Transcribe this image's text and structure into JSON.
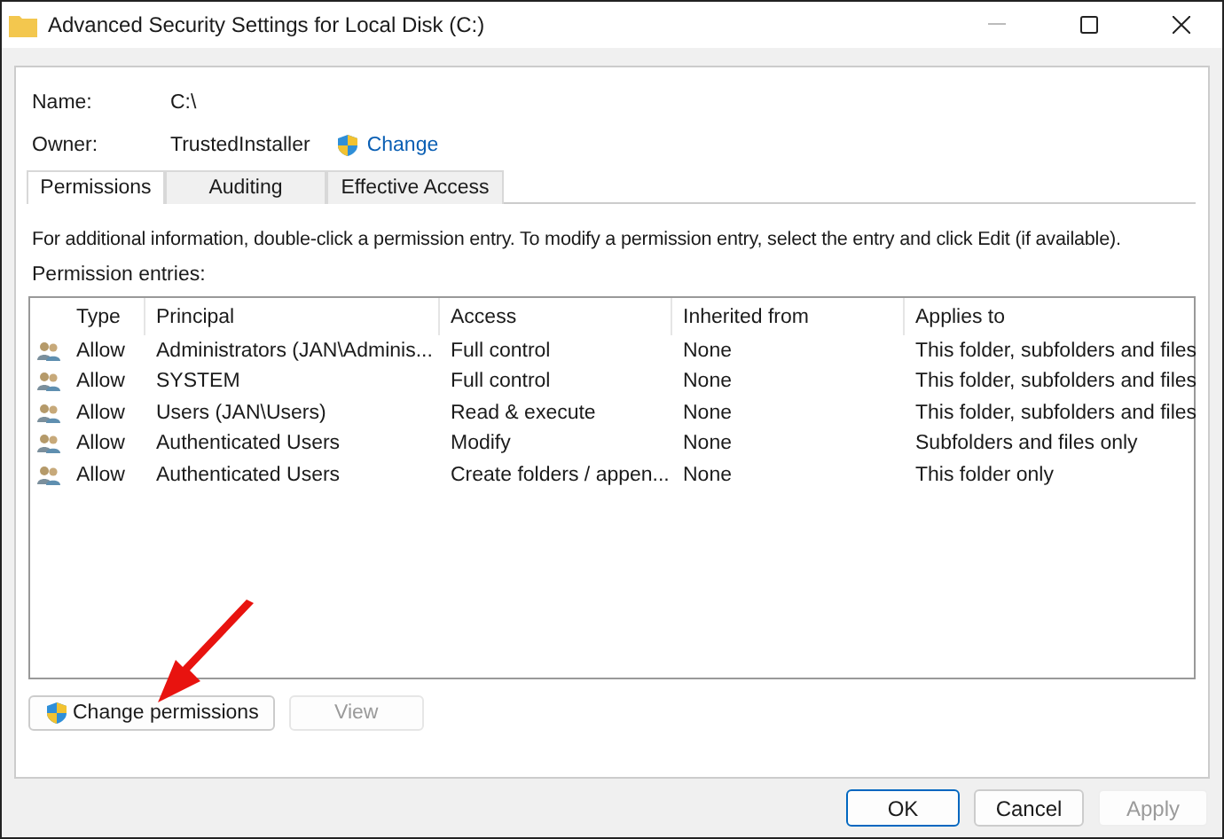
{
  "window": {
    "title": "Advanced Security Settings for Local Disk (C:)"
  },
  "name_field": {
    "label": "Name:",
    "value": "C:\\"
  },
  "owner": {
    "label": "Owner:",
    "value": "TrustedInstaller",
    "link": "Change"
  },
  "tabs": [
    {
      "label": "Permissions",
      "selected": true
    },
    {
      "label": "Auditing",
      "selected": false
    },
    {
      "label": "Effective Access",
      "selected": false
    }
  ],
  "info_text": "For additional information, double-click a permission entry. To modify a permission entry, select the entry and click Edit (if available).",
  "entries_label": "Permission entries:",
  "table": {
    "columns": [
      "Type",
      "Principal",
      "Access",
      "Inherited from",
      "Applies to"
    ],
    "rows": [
      [
        "Allow",
        "Administrators (JAN\\Adminis...",
        "Full control",
        "None",
        "This folder, subfolders and files"
      ],
      [
        "Allow",
        "SYSTEM",
        "Full control",
        "None",
        "This folder, subfolders and files"
      ],
      [
        "Allow",
        "Users (JAN\\Users)",
        "Read & execute",
        "None",
        "This folder, subfolders and files"
      ],
      [
        "Allow",
        "Authenticated Users",
        "Modify",
        "None",
        "Subfolders and files only"
      ],
      [
        "Allow",
        "Authenticated Users",
        "Create folders / appen...",
        "None",
        "This folder only"
      ]
    ]
  },
  "actions": [
    {
      "label": "Change permissions",
      "disabled": false,
      "shield": true
    },
    {
      "label": "View",
      "disabled": true,
      "shield": false
    }
  ],
  "footer_buttons": [
    {
      "label": "OK",
      "disabled": false,
      "default": true
    },
    {
      "label": "Cancel",
      "disabled": false,
      "default": false
    },
    {
      "label": "Apply",
      "disabled": true,
      "default": false
    }
  ]
}
